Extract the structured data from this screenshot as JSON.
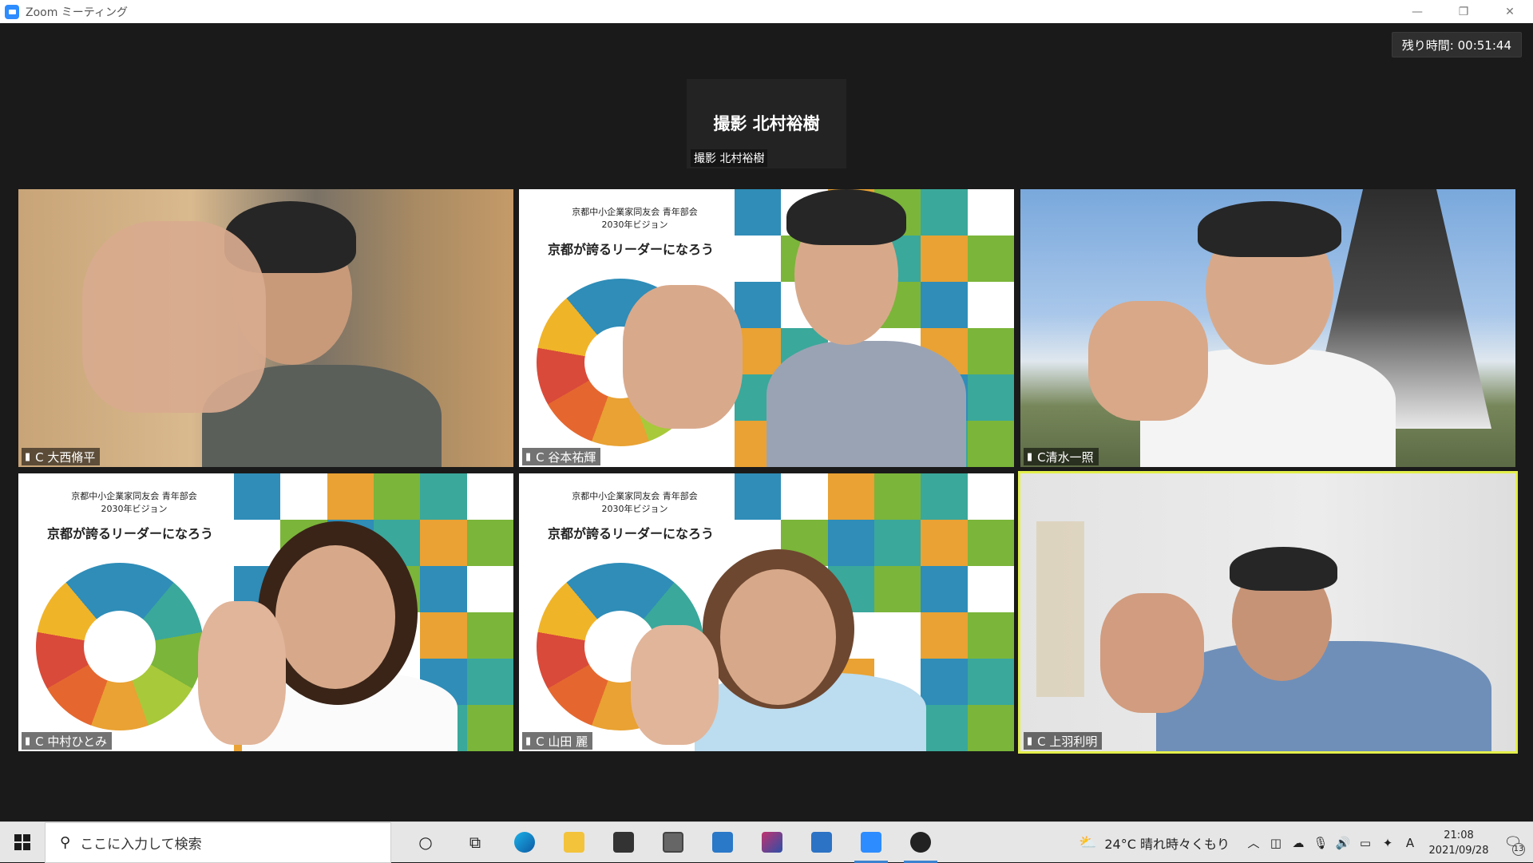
{
  "window": {
    "title": "Zoom ミーティング",
    "minimize": "—",
    "restore": "❐",
    "close": "✕"
  },
  "meeting": {
    "timer_label": "残り時間: 00:51:44",
    "active_speaker": {
      "display_name": "撮影 北村裕樹",
      "name_tag": "撮影 北村裕樹"
    },
    "tiles": [
      {
        "name": "C 大西脩平"
      },
      {
        "name": "C 谷本祐輝"
      },
      {
        "name": "C清水一照"
      },
      {
        "name": "C 中村ひとみ"
      },
      {
        "name": "C 山田 麗"
      },
      {
        "name": "C 上羽利明"
      }
    ],
    "slide": {
      "org": "京都中小企業家同友会  青年部会",
      "year": "2030年ビジョン",
      "headline": "京都が誇るリーダーになろう"
    }
  },
  "taskbar": {
    "search_placeholder": "ここに入力して検索",
    "icons": [
      "cortana-icon",
      "task-view-icon",
      "edge-icon",
      "file-explorer-icon",
      "store-icon",
      "photo-icon",
      "mail-icon",
      "app-icon",
      "calculator-icon",
      "zoom-icon",
      "app2-icon"
    ],
    "weather": "24°C  晴れ時々くもり",
    "time": "21:08",
    "date": "2021/09/28",
    "ime": "A",
    "notifications": "13"
  }
}
